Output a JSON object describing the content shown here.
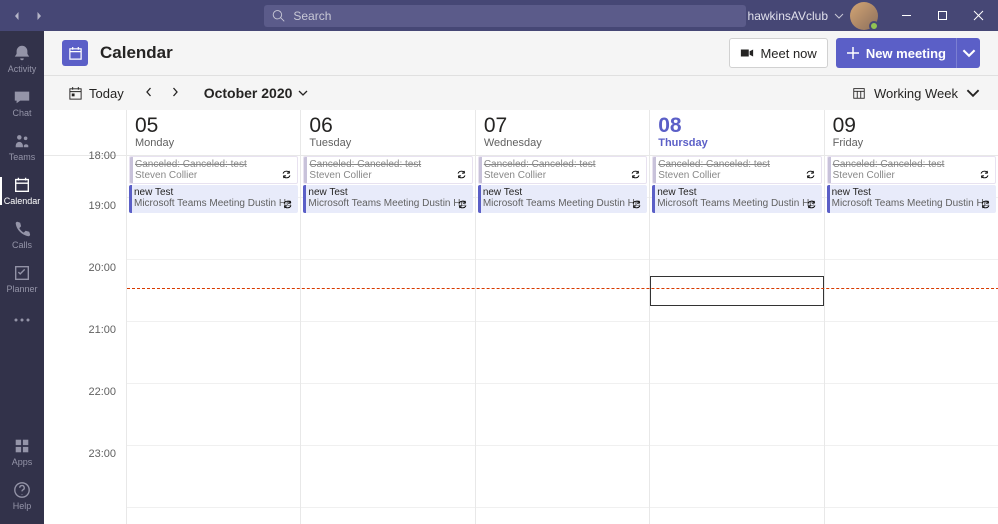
{
  "search": {
    "placeholder": "Search"
  },
  "account": {
    "name": "hawkinsAVclub"
  },
  "rail": {
    "activity": "Activity",
    "chat": "Chat",
    "teams": "Teams",
    "calendar": "Calendar",
    "calls": "Calls",
    "planner": "Planner",
    "apps": "Apps",
    "help": "Help"
  },
  "header": {
    "title": "Calendar"
  },
  "buttons": {
    "meet_now": "Meet now",
    "new_meeting": "New meeting",
    "today": "Today"
  },
  "month": "October 2020",
  "view": "Working Week",
  "times": [
    "18:00",
    "19:00",
    "20:00",
    "21:00",
    "22:00",
    "23:00"
  ],
  "days": [
    {
      "num": "05",
      "name": "Monday",
      "today": false
    },
    {
      "num": "06",
      "name": "Tuesday",
      "today": false
    },
    {
      "num": "07",
      "name": "Wednesday",
      "today": false
    },
    {
      "num": "08",
      "name": "Thursday",
      "today": true
    },
    {
      "num": "09",
      "name": "Friday",
      "today": false
    }
  ],
  "events": {
    "canceled": {
      "title": "Canceled: Canceled: test",
      "sub": "Steven Collier"
    },
    "meeting": {
      "title": "new Test",
      "sub": "Microsoft Teams Meeting  Dustin He"
    }
  }
}
